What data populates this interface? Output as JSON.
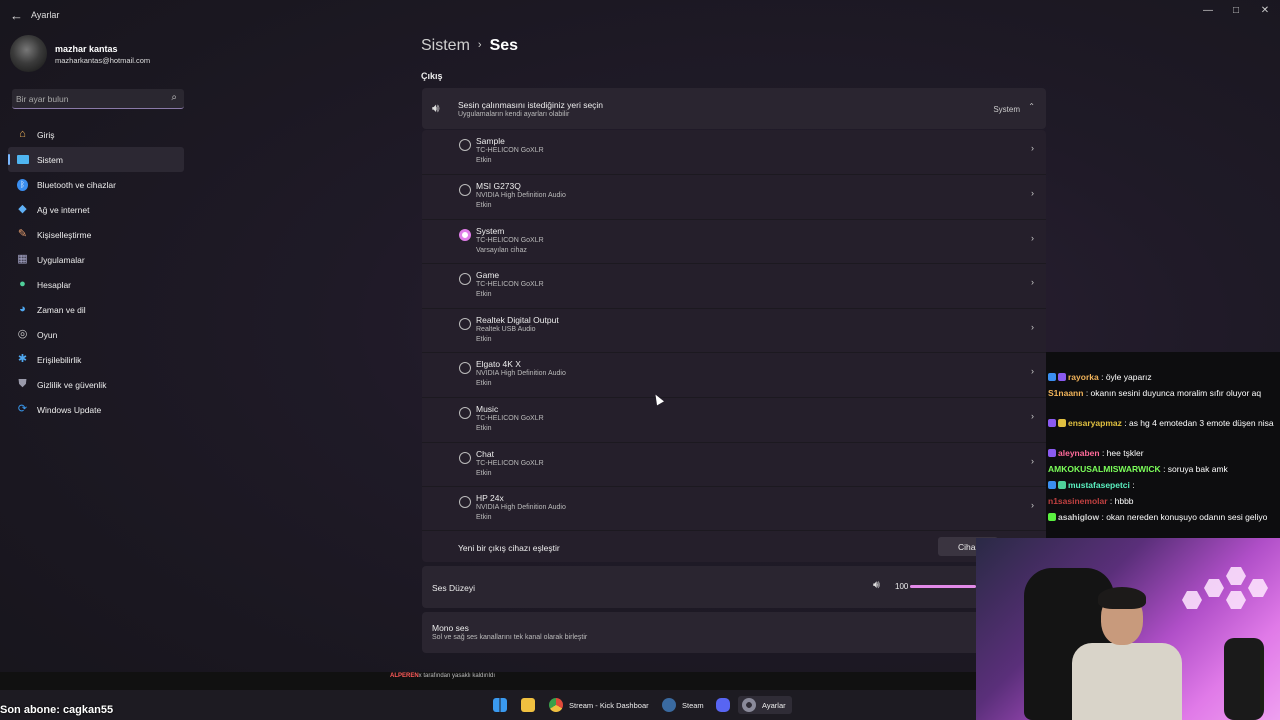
{
  "window": {
    "title": "Ayarlar",
    "controls": [
      "minimize",
      "maximize",
      "close"
    ]
  },
  "profile": {
    "name": "mazhar kantas",
    "email": "mazharkantas@hotmail.com"
  },
  "search": {
    "placeholder": "Bir ayar bulun"
  },
  "sidebar": {
    "items": [
      {
        "label": "Giriş",
        "icon": "home-icon",
        "color": "#f0b35a"
      },
      {
        "label": "Sistem",
        "icon": "monitor-icon",
        "color": "#4fb5f0",
        "active": true
      },
      {
        "label": "Bluetooth ve cihazlar",
        "icon": "bluetooth-icon",
        "color": "#3a8ef0"
      },
      {
        "label": "Ağ ve internet",
        "icon": "wifi-icon",
        "color": "#5fb0f5"
      },
      {
        "label": "Kişiselleştirme",
        "icon": "brush-icon",
        "color": "#e8a070"
      },
      {
        "label": "Uygulamalar",
        "icon": "apps-icon",
        "color": "#aaaacc"
      },
      {
        "label": "Hesaplar",
        "icon": "person-icon",
        "color": "#4fd09a"
      },
      {
        "label": "Zaman ve dil",
        "icon": "globe-clock-icon",
        "color": "#4fa8f0"
      },
      {
        "label": "Oyun",
        "icon": "gamepad-icon",
        "color": "#cccccc"
      },
      {
        "label": "Erişilebilirlik",
        "icon": "accessibility-icon",
        "color": "#4fa8f0"
      },
      {
        "label": "Gizlilik ve güvenlik",
        "icon": "shield-icon",
        "color": "#9a9aaa"
      },
      {
        "label": "Windows Update",
        "icon": "update-icon",
        "color": "#3a9af0"
      }
    ]
  },
  "breadcrumb": {
    "parent": "Sistem",
    "separator": "›",
    "current": "Ses"
  },
  "output": {
    "section_label": "Çıkış",
    "title": "Sesin çalınmasını istediğiniz yeri seçin",
    "subtitle": "Uygulamaların kendi ayarları olabilir",
    "selected": "System",
    "devices": [
      {
        "name": "Sample",
        "driver": "TC-HELICON GoXLR",
        "status": "Etkin",
        "selected": false
      },
      {
        "name": "MSI G273Q",
        "driver": "NVIDIA High Definition Audio",
        "status": "Etkin",
        "selected": false
      },
      {
        "name": "System",
        "driver": "TC-HELICON GoXLR",
        "status": "Varsayılan cihaz",
        "selected": true
      },
      {
        "name": "Game",
        "driver": "TC-HELICON GoXLR",
        "status": "Etkin",
        "selected": false
      },
      {
        "name": "Realtek Digital Output",
        "driver": "Realtek USB Audio",
        "status": "Etkin",
        "selected": false
      },
      {
        "name": "Elgato 4K X",
        "driver": "NVIDIA High Definition Audio",
        "status": "Etkin",
        "selected": false
      },
      {
        "name": "Music",
        "driver": "TC-HELICON GoXLR",
        "status": "Etkin",
        "selected": false
      },
      {
        "name": "Chat",
        "driver": "TC-HELICON GoXLR",
        "status": "Etkin",
        "selected": false
      },
      {
        "name": "HP 24x",
        "driver": "NVIDIA High Definition Audio",
        "status": "Etkin",
        "selected": false
      }
    ],
    "pair_label": "Yeni bir çıkış cihazı eşleştir",
    "pair_button": "Cihaz"
  },
  "volume": {
    "label": "Ses Düzeyi",
    "value": "100",
    "level": 1.0
  },
  "mono": {
    "title": "Mono ses",
    "subtitle": "Sol ve sağ ses kanallarını tek kanal olarak birleştir"
  },
  "chat": {
    "messages": [
      {
        "user": "rayorka",
        "text": ": öyle yaparız",
        "color": "#f0b35a"
      },
      {
        "user": "S1naann",
        "text": ": okanın sesini duyunca moralim sıfır oluyor aq",
        "color": "#f0b35a"
      },
      {
        "user": "ensaryapmaz",
        "text": ": as hg 4 emotedan 3 emote düşen nisa",
        "color": "#e0c040"
      },
      {
        "user": "aleynaben",
        "text": ": hee tşkler",
        "color": "#ff6a9a"
      },
      {
        "user": "AMKOKUSALMISWARWICK",
        "text": ": soruya bak amk",
        "color": "#7cff5a"
      },
      {
        "user": "mustafasepetci",
        "text": ":",
        "color": "#5af0c0"
      },
      {
        "user": "n1sasinemolar",
        "text": ": hbbb",
        "color": "#c04040"
      },
      {
        "user": "asahiglow",
        "text": ": okan nereden konuşuyo odanın sesi geliyo",
        "color": "#cfcfcf"
      }
    ]
  },
  "overlay": {
    "last_sub": "Son abone: cagkan55",
    "alert_name": "ALPEREN",
    "alert_text": "x tarafından yasaklı kaldırıldı"
  },
  "taskbar": {
    "items": [
      {
        "label": "",
        "icon": "windows-start-icon",
        "color": "#3a9af0"
      },
      {
        "label": "",
        "icon": "folder-icon",
        "color": "#f0c040"
      },
      {
        "label": "Stream - Kick Dashboar",
        "icon": "chrome-icon",
        "color": "#e04a3a"
      },
      {
        "label": "Steam",
        "icon": "steam-icon",
        "color": "#3a6aa0"
      },
      {
        "label": "",
        "icon": "discord-icon",
        "color": "#5865f2"
      },
      {
        "label": "Ayarlar",
        "icon": "settings-gear-icon",
        "color": "#8a8a9a"
      }
    ]
  }
}
